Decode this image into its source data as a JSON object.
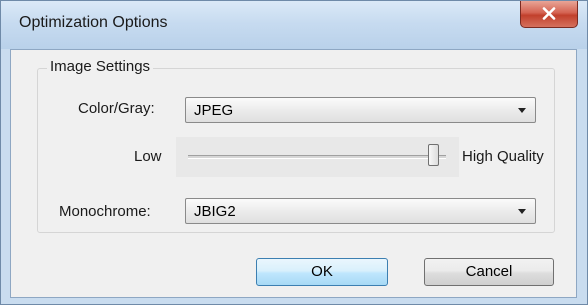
{
  "window": {
    "title": "Optimization Options",
    "close_icon": "close-x-icon"
  },
  "group": {
    "label": "Image Settings"
  },
  "color_gray": {
    "label": "Color/Gray:",
    "value": "JPEG"
  },
  "quality": {
    "low_label": "Low",
    "high_label": "High Quality",
    "level": 0.97
  },
  "monochrome": {
    "label": "Monochrome:",
    "value": "JBIG2"
  },
  "buttons": {
    "ok": "OK",
    "cancel": "Cancel"
  },
  "colors": {
    "titlebar": "#c7dbf0",
    "close_button": "#c1402c",
    "dialog_background": "#f0f0f0",
    "default_button_border": "#3c7fb1"
  }
}
